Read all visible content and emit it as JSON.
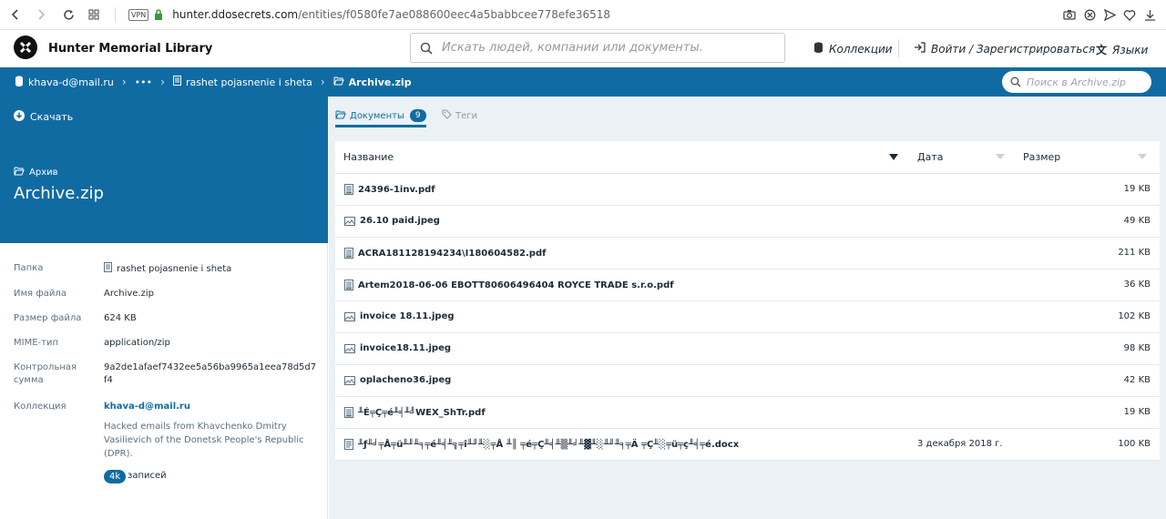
{
  "browser": {
    "url_host": "hunter.ddosecrets.com",
    "url_path": "/entities/f0580fe7ae088600eec4a5babbcee778efe36518",
    "vpn_label": "VPN"
  },
  "header": {
    "brand": "Hunter Memorial Library",
    "search_placeholder": "Искать людей, компании или документы.",
    "collections": "Коллекции",
    "login": "Войти / Зарегистрироваться",
    "languages": "Языки"
  },
  "breadcrumb": {
    "root": "khava-d@mail.ru",
    "ellipsis": "•••",
    "folder": "rashet pojasnenie i sheta",
    "current": "Archive.zip",
    "search_placeholder": "Поиск в Archive.zip"
  },
  "sidebar": {
    "download": "Скачать",
    "type_label": "Архив",
    "title": "Archive.zip",
    "meta": {
      "folder_key": "Папка",
      "folder_val": "rashet pojasnenie i sheta",
      "filename_key": "Имя файла",
      "filename_val": "Archive.zip",
      "size_key": "Размер файла",
      "size_val": "624 KB",
      "mime_key": "MIME-тип",
      "mime_val": "application/zip",
      "checksum_key_1": "Контрольная",
      "checksum_key_2": "сумма",
      "checksum_val_1": "9a2de1afaef7432ee5a56ba9965a1eea78d5d7",
      "checksum_val_2": "f4",
      "collection_key": "Коллекция",
      "collection_val": "khava-d@mail.ru",
      "collection_desc": "Hacked emails from Khavchenko Dmitry Vasilievich of the Donetsk People's Republic (DPR).",
      "count": "4k",
      "count_label": "записей"
    }
  },
  "tabs": {
    "docs": "Документы",
    "docs_count": "9",
    "tags": "Теги"
  },
  "table": {
    "col_name": "Название",
    "col_date": "Дата",
    "col_size": "Размер",
    "rows": [
      {
        "icon": "pdf-icon",
        "name": "24396-1inv.pdf",
        "date": "",
        "size": "19 KB"
      },
      {
        "icon": "image-icon",
        "name": "26.10 paid.jpeg",
        "date": "",
        "size": "49 KB"
      },
      {
        "icon": "pdf-icon",
        "name": "ACRA181128194234\\I180604582.pdf",
        "date": "",
        "size": "211 KB"
      },
      {
        "icon": "pdf-icon",
        "name": "Artem2018-06-06 EBOTT80606496404 ROYCE TRADE s.r.o.pdf",
        "date": "",
        "size": "36 KB"
      },
      {
        "icon": "image-icon",
        "name": "invoice 18.11.jpeg",
        "date": "",
        "size": "102 KB"
      },
      {
        "icon": "image-icon",
        "name": "invoice18.11.jpeg",
        "date": "",
        "size": "98 KB"
      },
      {
        "icon": "image-icon",
        "name": "oplacheno36.jpeg",
        "date": "",
        "size": "42 KB"
      },
      {
        "icon": "pdf-icon",
        "name": "╨É╤Ç╤é╨╡╨╝WEX_ShTr.pdf",
        "date": "",
        "size": "19 KB"
      },
      {
        "icon": "docx-icon",
        "name": "╨ƒ╨╛╤Å╤ü╨╜╨╕╤é╨╡╨╗╤î╨╜╨░╤Å ╨║ ╤é╤Ç╨╡╨▒╨╛╨▓╨░╨╜╨╕╤Ä ╤Ç╨░╤ü╤ç╨╡╤é.docx",
        "date": "3 декабря 2018 г.",
        "size": "100 KB"
      }
    ]
  },
  "colors": {
    "primary": "#106ba3",
    "background": "#ebf1f5"
  }
}
